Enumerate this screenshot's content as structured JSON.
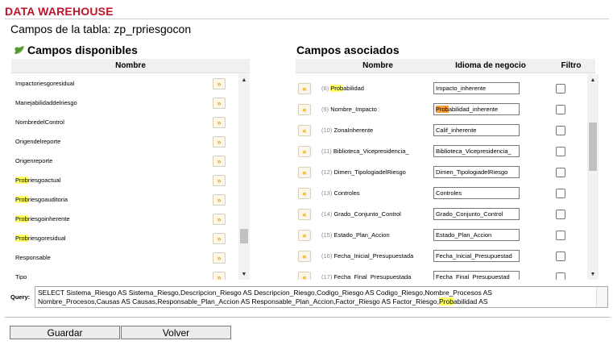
{
  "app": {
    "title": "DATA WAREHOUSE"
  },
  "table_caption": "Campos de la tabla: zp_rpriesgocon",
  "left": {
    "title": "Campos disponibles",
    "col_header": "Nombre",
    "items": [
      {
        "pre": "",
        "hl": "",
        "post": "Impactoriesgoresidual"
      },
      {
        "pre": "",
        "hl": "",
        "post": "Manejabilidaddelriesgo"
      },
      {
        "pre": "",
        "hl": "",
        "post": "NombredelControl"
      },
      {
        "pre": "",
        "hl": "",
        "post": "Origendelreporte"
      },
      {
        "pre": "",
        "hl": "",
        "post": "Origenreporte"
      },
      {
        "pre": "",
        "hl": "Prob",
        "post": "riesgoactual"
      },
      {
        "pre": "",
        "hl": "Prob",
        "post": "riesgoauditoria"
      },
      {
        "pre": "",
        "hl": "Prob",
        "post": "riesgoinherente"
      },
      {
        "pre": "",
        "hl": "Prob",
        "post": "riesgoresidual"
      },
      {
        "pre": "",
        "hl": "",
        "post": "Responsable"
      },
      {
        "pre": "",
        "hl": "",
        "post": "Tipo"
      }
    ],
    "move_glyph": "»"
  },
  "right": {
    "title": "Campos asociados",
    "col_headers": [
      "Nombre",
      "Idioma de negocio",
      "Filtro"
    ],
    "remove_glyph": "«",
    "items": [
      {
        "num": "(8)",
        "pre": "",
        "hl": "Prob",
        "post": "abilidad",
        "value_hl": "",
        "value": "Impacto_inherente"
      },
      {
        "num": "(9)",
        "pre": "Nombre_Impacto",
        "hl": "",
        "post": "",
        "value_hl": "Prob",
        "value": "abilidad_inherente"
      },
      {
        "num": "(10)",
        "pre": "ZonaInherente",
        "hl": "",
        "post": "",
        "value_hl": "",
        "value": "Calif_inherente"
      },
      {
        "num": "(11)",
        "pre": "Biblioteca_Vicepresidencia_",
        "hl": "",
        "post": "",
        "value_hl": "",
        "value": "Biblioteca_Vicepresidencia_"
      },
      {
        "num": "(12)",
        "pre": "Dimen_TipologiadelRiesgo",
        "hl": "",
        "post": "",
        "value_hl": "",
        "value": "Dimen_TipologiadelRiesgo"
      },
      {
        "num": "(13)",
        "pre": "Controles",
        "hl": "",
        "post": "",
        "value_hl": "",
        "value": "Controles"
      },
      {
        "num": "(14)",
        "pre": "Grado_Conjunto_Control",
        "hl": "",
        "post": "",
        "value_hl": "",
        "value": "Grado_Conjunto_Control"
      },
      {
        "num": "(15)",
        "pre": "Estado_Plan_Accion",
        "hl": "",
        "post": "",
        "value_hl": "",
        "value": "Estado_Plan_Accion"
      },
      {
        "num": "(16)",
        "pre": "Fecha_Inicial_Presupuestada",
        "hl": "",
        "post": "",
        "value_hl": "",
        "value": "Fecha_Inicial_Presupuestad"
      },
      {
        "num": "(17)",
        "pre": "Fecha_Final_Presupuestada",
        "hl": "",
        "post": "",
        "value_hl": "",
        "value": "Fecha_Final_Presupuestad"
      }
    ]
  },
  "query": {
    "label": "Query:",
    "line1": "SELECT Sistema_Riesgo AS Sistema_Riesgo,Descripcion_Riesgo AS Descripcion_Riesgo,Codigo_Riesgo AS Codigo_Riesgo,Nombre_Procesos AS",
    "line2_pre": "Nombre_Procesos,Causas AS Causas,Responsable_Plan_Accion AS Responsable_Plan_Accion,Factor_Riesgo AS Factor_Riesgo,",
    "line2_hl": "Prob",
    "line2_post": "abilidad AS"
  },
  "buttons": {
    "save": "Guardar",
    "back": "Volver"
  },
  "colors": {
    "title": "#c0142a",
    "highlight": "#ffff66",
    "highlight_active": "#f5a040",
    "arrow": "#f2a000"
  },
  "icons": {
    "section": "leaf-icon",
    "add": "double-chevron-right-icon",
    "remove": "double-chevron-left-icon"
  }
}
